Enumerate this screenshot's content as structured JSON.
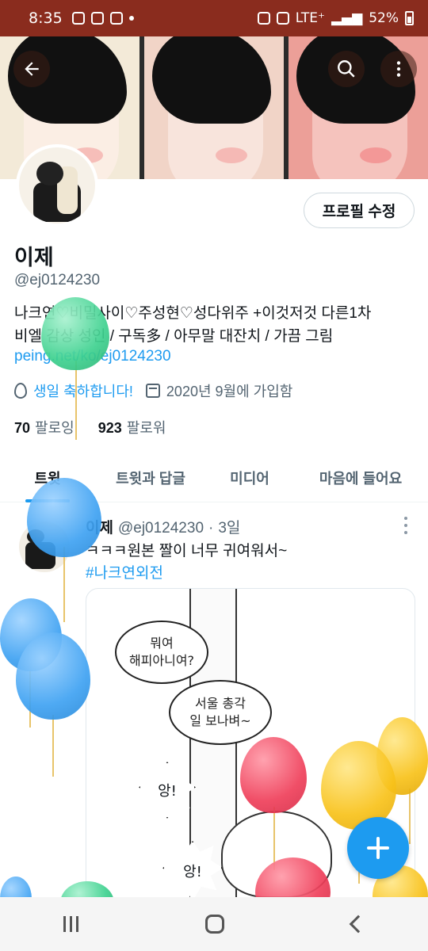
{
  "status_bar": {
    "time": "8:35",
    "network": "LTE⁺",
    "battery": "52%"
  },
  "profile": {
    "edit_button": "프로필 수정",
    "name": "이제",
    "handle": "@ej0124230",
    "bio_line1": "나크연♡비밀사이♡주성현♡성다위주 +이것저것 다른1차",
    "bio_line2": "비엘 감상  성인 / 구독多 / 아무말 대잔치 / 가끔 그림",
    "link": "peing.net/ko/ej0124230",
    "birthday": "생일 축하합니다!",
    "joined": "2020년 9월에 가입함",
    "following_count": "70",
    "following_label": "팔로잉",
    "followers_count": "923",
    "followers_label": "팔로워"
  },
  "tabs": [
    {
      "label": "트윗",
      "active": true
    },
    {
      "label": "트윗과 답글",
      "active": false
    },
    {
      "label": "미디어",
      "active": false
    },
    {
      "label": "마음에 들어요",
      "active": false
    }
  ],
  "tweet": {
    "name": "이제",
    "handle": "@ej0124230",
    "separator": "·",
    "time": "3일",
    "text": "ㅋㅋㅋ원본 짤이 너무 귀여워서~",
    "hashtag": "#나크연외전",
    "image_bubbles": {
      "b1_line1": "뭐여",
      "b1_line2": "해피아니여?",
      "b2_line1": "서울 총각",
      "b2_line2": "일 보나벼~",
      "burst1": "앙!",
      "burst2": "앙!"
    }
  },
  "colors": {
    "status_bar_bg": "#8a2c1e",
    "accent": "#1d9bf0",
    "secondary_text": "#536471"
  },
  "icons": {
    "back": "back-arrow-icon",
    "search": "search-icon",
    "more": "more-vertical-icon",
    "birthday": "balloon-icon",
    "calendar": "calendar-icon",
    "compose": "plus-icon"
  }
}
